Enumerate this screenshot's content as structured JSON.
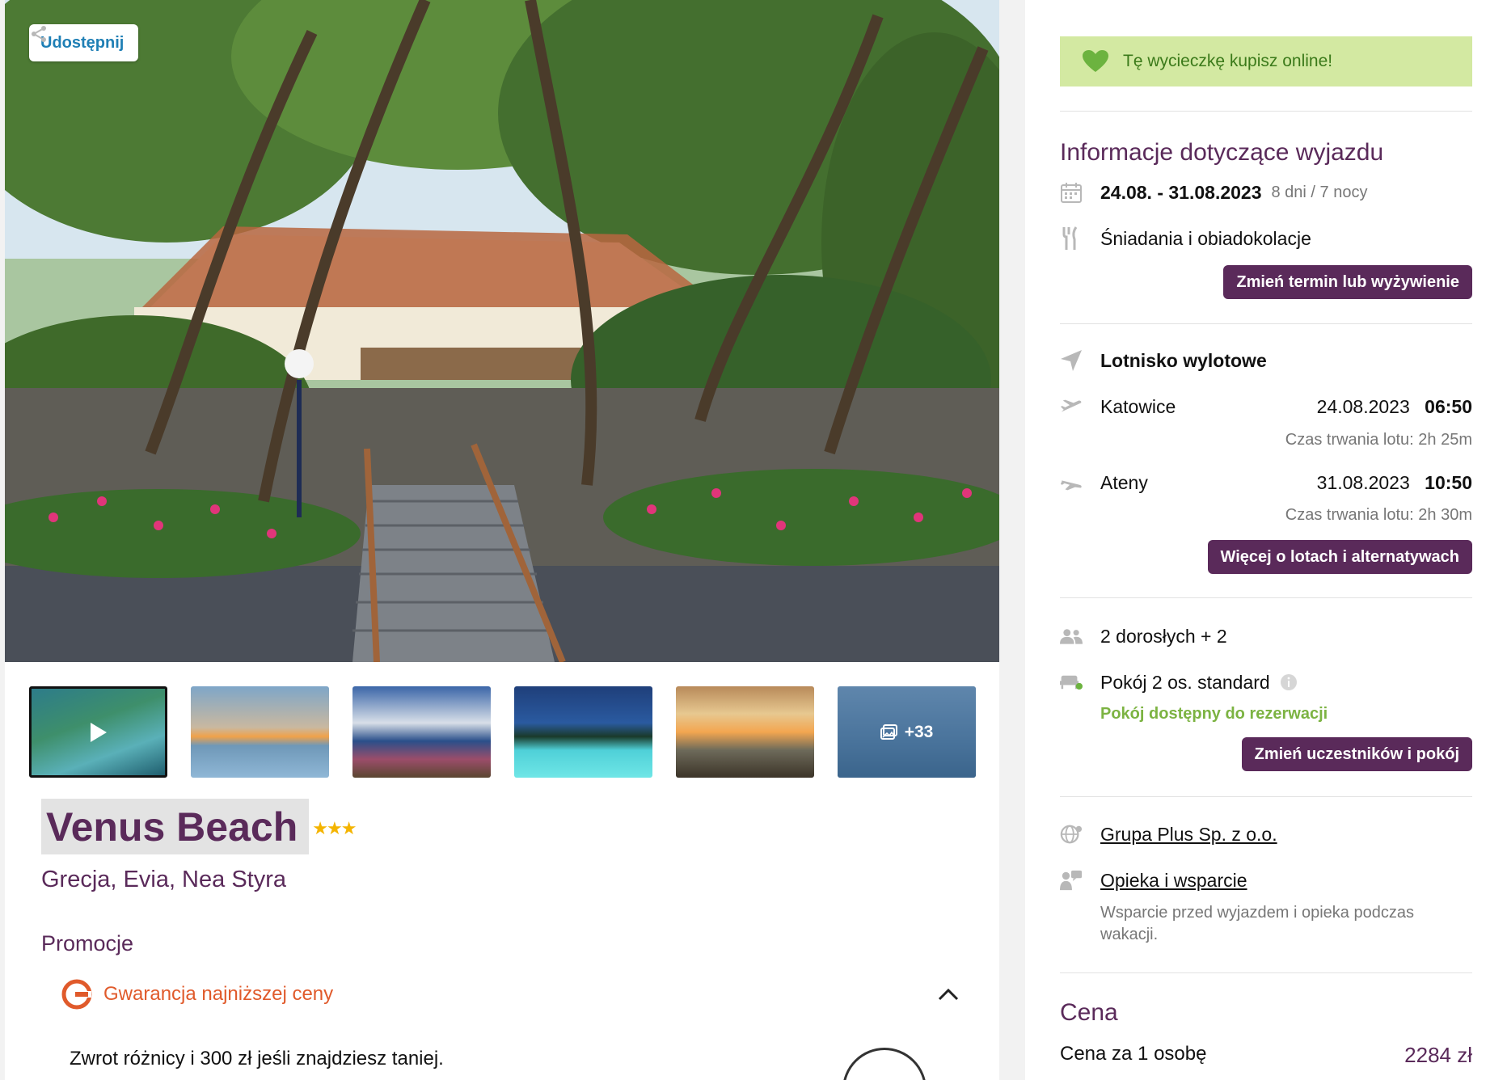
{
  "share": {
    "label": "Udostępnij"
  },
  "gallery": {
    "more_count": "+33"
  },
  "hotel": {
    "name": "Venus Beach",
    "stars": "★★★",
    "location": "Grecja, Evia, Nea Styra"
  },
  "promotions": {
    "title": "Promocje",
    "item_label": "Gwarancja najniższej ceny",
    "description": "Zwrot różnicy i 300 zł jeśli znajdziesz taniej."
  },
  "sidebar": {
    "buy_online": "Tę wycieczkę kupisz online!",
    "trip_info": {
      "title": "Informacje dotyczące wyjazdu",
      "dates": "24.08. - 31.08.2023",
      "duration": "8 dni / 7 nocy",
      "board": "Śniadania i obiadokolacje",
      "change_button": "Zmień termin lub wyżywienie"
    },
    "flights": {
      "title": "Lotnisko wylotowe",
      "outbound": {
        "city": "Katowice",
        "date": "24.08.2023",
        "time": "06:50",
        "duration": "Czas trwania lotu: 2h 25m"
      },
      "return": {
        "city": "Ateny",
        "date": "31.08.2023",
        "time": "10:50",
        "duration": "Czas trwania lotu: 2h 30m"
      },
      "more_button": "Więcej o lotach i alternatywach"
    },
    "participants": {
      "people": "2 dorosłych + 2",
      "room": "Pokój 2 os. standard",
      "availability": "Pokój dostępny do rezerwacji",
      "change_button": "Zmień uczestników i pokój"
    },
    "organizer": {
      "company": "Grupa Plus Sp. z o.o.",
      "support": "Opieka i wsparcie",
      "support_note": "Wsparcie przed wyjazdem i opieka podczas wakacji."
    },
    "price": {
      "title": "Cena",
      "per_person_label": "Cena za 1 osobę",
      "per_person_value": "2284 zł"
    }
  },
  "colors": {
    "brand": "#5a2a5a",
    "link": "#1f7fb5",
    "accent_orange": "#e05a2b",
    "success": "#7cb342",
    "banner_bg": "#d3e9a2"
  }
}
